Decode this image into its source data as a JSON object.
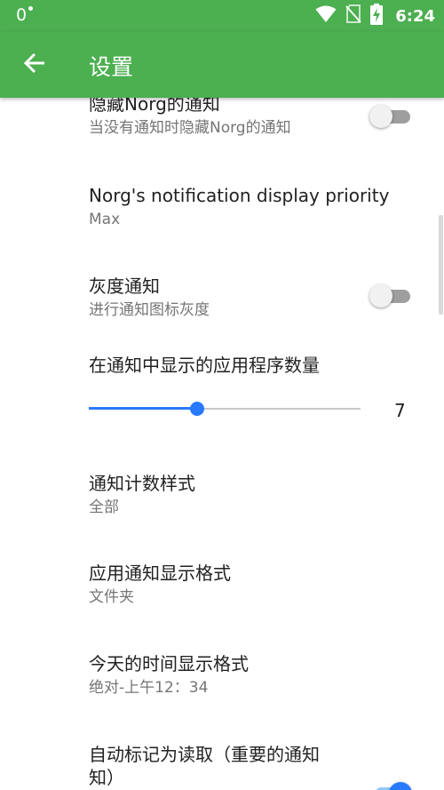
{
  "status_bar": {
    "left_text": "0",
    "time": "6:24",
    "icons": [
      "wifi-icon",
      "no-sim-icon",
      "battery-charging-icon"
    ]
  },
  "app_bar": {
    "title": "设置",
    "back_icon": "arrow-left-icon"
  },
  "settings": [
    {
      "title": "隐藏Norg的通知",
      "summary": "当没有通知时隐藏Norg的通知",
      "switch_on": false
    },
    {
      "title": "Norg's notification display priority",
      "summary": "Max"
    },
    {
      "title": "灰度通知",
      "summary": "进行通知图标灰度",
      "switch_on": false
    },
    {
      "title": "在通知中显示的应用程序数量",
      "slider_value": "7",
      "slider_fraction": 0.4
    },
    {
      "title": "通知计数样式",
      "summary": "全部"
    },
    {
      "title": "应用通知显示格式",
      "summary": "文件夹"
    },
    {
      "title": "今天的时间显示格式",
      "summary": "绝对-上午12：34"
    },
    {
      "title": "自动标记为读取（重要的通知",
      "title_line2": "知）",
      "switch_on": true
    }
  ],
  "colors": {
    "primary": "#4caf50",
    "accent": "#2979ff",
    "text_primary": "#212121",
    "text_secondary": "#757575"
  }
}
